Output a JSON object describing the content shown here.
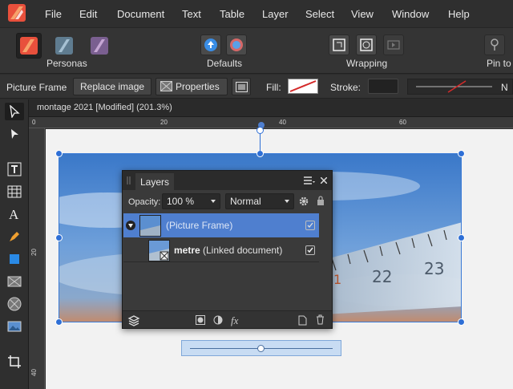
{
  "menu": {
    "items": [
      "File",
      "Edit",
      "Document",
      "Text",
      "Table",
      "Layer",
      "Select",
      "View",
      "Window",
      "Help"
    ]
  },
  "toolbar": {
    "personas_label": "Personas",
    "defaults_label": "Defaults",
    "wrapping_label": "Wrapping",
    "pin_label": "Pin to"
  },
  "context": {
    "type_label": "Picture Frame",
    "replace_label": "Replace image",
    "properties_label": "Properties",
    "fill_label": "Fill:",
    "stroke_label": "Stroke:",
    "line_label": "N"
  },
  "document": {
    "title": "montage 2021 [Modified] (201.3%)"
  },
  "rulers": {
    "top": [
      "0",
      "20",
      "40",
      "60"
    ],
    "left": [
      "20",
      "40"
    ]
  },
  "layers_panel": {
    "tab": "Layers",
    "opacity_label": "Opacity:",
    "opacity_value": "100 %",
    "blend_mode": "Normal",
    "layers": [
      {
        "name": "(Picture Frame)",
        "selected": true,
        "visible": true
      },
      {
        "name_bold": "metre",
        "name_rest": " (Linked document)",
        "selected": false,
        "visible": true
      }
    ]
  },
  "photo_ruler_numbers": [
    "22",
    "23",
    "1"
  ],
  "colors": {
    "accent": "#2e6fd6",
    "selection": "#4f7fcf",
    "canvas": "#f2f2f2"
  }
}
